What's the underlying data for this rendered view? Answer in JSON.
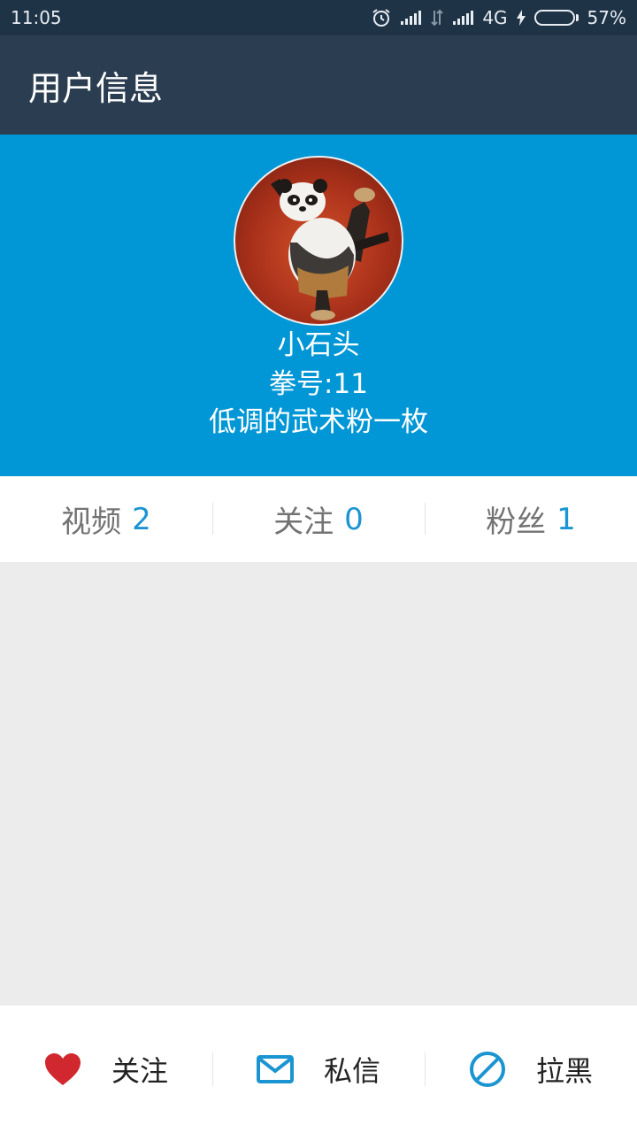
{
  "status_bar": {
    "time": "11:05",
    "network": "4G",
    "battery": "57%",
    "battery_level": 0.57
  },
  "app_bar": {
    "title": "用户信息"
  },
  "profile": {
    "name": "小石头",
    "number": "拳号:11",
    "bio": "低调的武术粉一枚"
  },
  "stats": [
    {
      "label": "视频",
      "value": "2"
    },
    {
      "label": "关注",
      "value": "0"
    },
    {
      "label": "粉丝",
      "value": "1"
    }
  ],
  "actions": [
    {
      "label": "关注",
      "icon": "heart-icon",
      "color": "#d0282e"
    },
    {
      "label": "私信",
      "icon": "mail-icon",
      "color": "#1b95d2"
    },
    {
      "label": "拉黑",
      "icon": "block-icon",
      "color": "#1b95d2"
    }
  ],
  "colors": {
    "status_bar": "#1f3347",
    "app_bar": "#2b3d51",
    "profile_bg": "#0196d5",
    "accent": "#1b95d2"
  }
}
